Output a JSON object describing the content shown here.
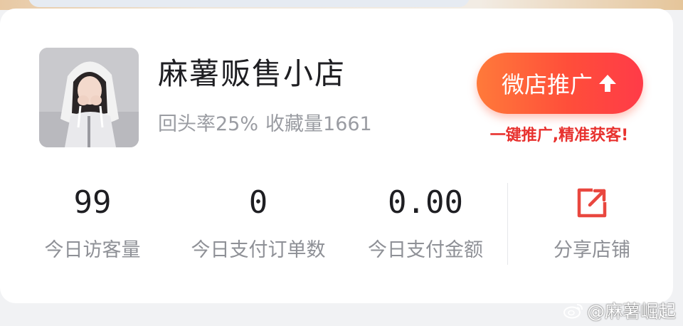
{
  "shop": {
    "name": "麻薯贩售小店",
    "return_rate": "回头率25%",
    "favorites": "收藏量1661"
  },
  "promo": {
    "button_label": "微店推广",
    "subtitle": "一键推广,精准获客!",
    "accent_color": "#ff4e3a"
  },
  "stats": [
    {
      "value": "99",
      "label": "今日访客量"
    },
    {
      "value": "0",
      "label": "今日支付订单数"
    },
    {
      "value": "0.00",
      "label": "今日支付金额"
    }
  ],
  "share": {
    "label": "分享店铺",
    "icon": "share-arrow-icon",
    "color": "#e9473f"
  },
  "watermark": {
    "text": "@麻薯崛起",
    "icon": "weibo-icon"
  }
}
